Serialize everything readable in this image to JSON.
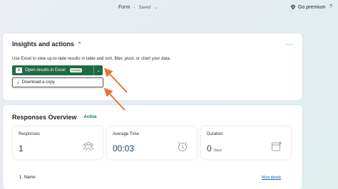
{
  "topbar": {
    "form_title": "Form",
    "separator": "-",
    "save_status": "Saved",
    "premium_label": "Go premium",
    "help_label": "?"
  },
  "insights": {
    "title": "Insights and actions",
    "more_label": "...",
    "description": "Use Excel to view up-to-date results in table and sort, filter, pivot, or chart your data.",
    "open_excel_label": "Open results in Excel",
    "open_excel_badge": "Autoplay",
    "dropdown_item": "Download a copy"
  },
  "responses": {
    "title": "Responses Overview",
    "status": "Active",
    "stats": [
      {
        "label": "Responses",
        "value": "1",
        "unit": ""
      },
      {
        "label": "Average Time",
        "value": "00:03",
        "unit": ""
      },
      {
        "label": "Duration",
        "value": "0",
        "unit": "Days"
      }
    ],
    "question_label": "1. Name",
    "more_details_label": "More details"
  },
  "colors": {
    "excel_green": "#1f6b45",
    "arrow_orange": "#e8732e",
    "link_blue": "#0f6cbd"
  }
}
